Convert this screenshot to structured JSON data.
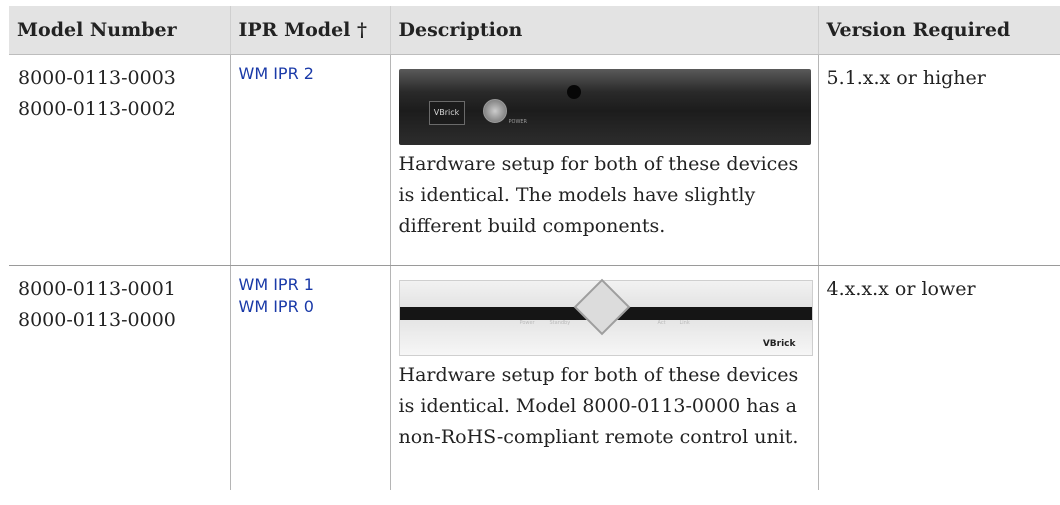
{
  "table": {
    "headers": [
      "Model Number",
      "IPR Model †",
      "Description",
      "Version Required"
    ],
    "rows": [
      {
        "models": [
          "8000-0113-0003",
          "8000-0113-0002"
        ],
        "ipr": [
          "WM IPR 2"
        ],
        "device_image": "black-device",
        "device_labels": {
          "logo": "VBrick",
          "power": "POWER"
        },
        "description": "Hardware setup for both of these devices is identical. The models have slightly different build components.",
        "version": "5.1.x.x or higher"
      },
      {
        "models": [
          "8000-0113-0001",
          "8000-0113-0000"
        ],
        "ipr": [
          "WM IPR 1",
          "WM IPR 0"
        ],
        "device_image": "silver-device",
        "device_labels": {
          "power": "Power",
          "standby": "Standby",
          "act": "Act",
          "link": "Link",
          "brand": "VBrick"
        },
        "description": "Hardware setup for both of these devices is identical. Model 8000-0113-0000 has a non-RoHS-compliant remote control unit.",
        "version": "4.x.x.x or lower"
      }
    ]
  }
}
